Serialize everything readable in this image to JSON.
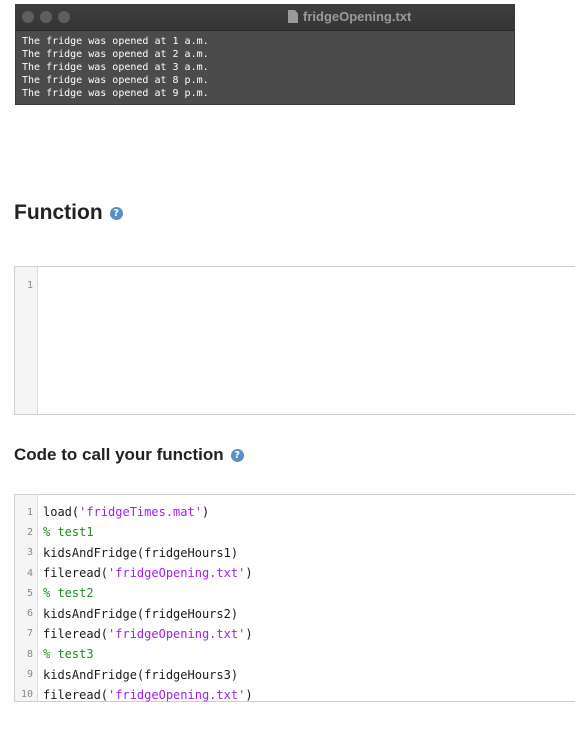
{
  "terminal": {
    "title": "fridgeOpening.txt",
    "lines": [
      "The fridge was opened at 1 a.m.",
      "The fridge was opened at 2 a.m.",
      "The fridge was opened at 3 a.m.",
      "The fridge was opened at 8 p.m.",
      "The fridge was opened at 9 p.m."
    ]
  },
  "function_section": {
    "heading": "Function",
    "help_icon": "?",
    "line_numbers": [
      "1"
    ]
  },
  "call_section": {
    "heading": "Code to call your function",
    "help_icon": "?",
    "lines": [
      {
        "num": "1",
        "parts": [
          {
            "t": "load(",
            "k": "p"
          },
          {
            "t": "'fridgeTimes.mat'",
            "k": "s"
          },
          {
            "t": ")",
            "k": "p"
          }
        ]
      },
      {
        "num": "2",
        "parts": [
          {
            "t": "% test1",
            "k": "c"
          }
        ]
      },
      {
        "num": "3",
        "parts": [
          {
            "t": "kidsAndFridge(fridgeHours1)",
            "k": "p"
          }
        ]
      },
      {
        "num": "4",
        "parts": [
          {
            "t": "fileread(",
            "k": "p"
          },
          {
            "t": "'fridgeOpening.txt'",
            "k": "s"
          },
          {
            "t": ")",
            "k": "p"
          }
        ]
      },
      {
        "num": "5",
        "parts": [
          {
            "t": "% test2",
            "k": "c"
          }
        ]
      },
      {
        "num": "6",
        "parts": [
          {
            "t": "kidsAndFridge(fridgeHours2)",
            "k": "p"
          }
        ]
      },
      {
        "num": "7",
        "parts": [
          {
            "t": "fileread(",
            "k": "p"
          },
          {
            "t": "'fridgeOpening.txt'",
            "k": "s"
          },
          {
            "t": ")",
            "k": "p"
          }
        ]
      },
      {
        "num": "8",
        "parts": [
          {
            "t": "% test3",
            "k": "c"
          }
        ]
      },
      {
        "num": "9",
        "parts": [
          {
            "t": "kidsAndFridge(fridgeHours3)",
            "k": "p"
          }
        ]
      },
      {
        "num": "10",
        "parts": [
          {
            "t": "fileread(",
            "k": "p"
          },
          {
            "t": "'fridgeOpening.txt'",
            "k": "s"
          },
          {
            "t": ")",
            "k": "p"
          }
        ]
      }
    ]
  },
  "colors": {
    "string": "#a020f0",
    "comment": "#228b22",
    "help_icon": "#5a8fc8"
  }
}
